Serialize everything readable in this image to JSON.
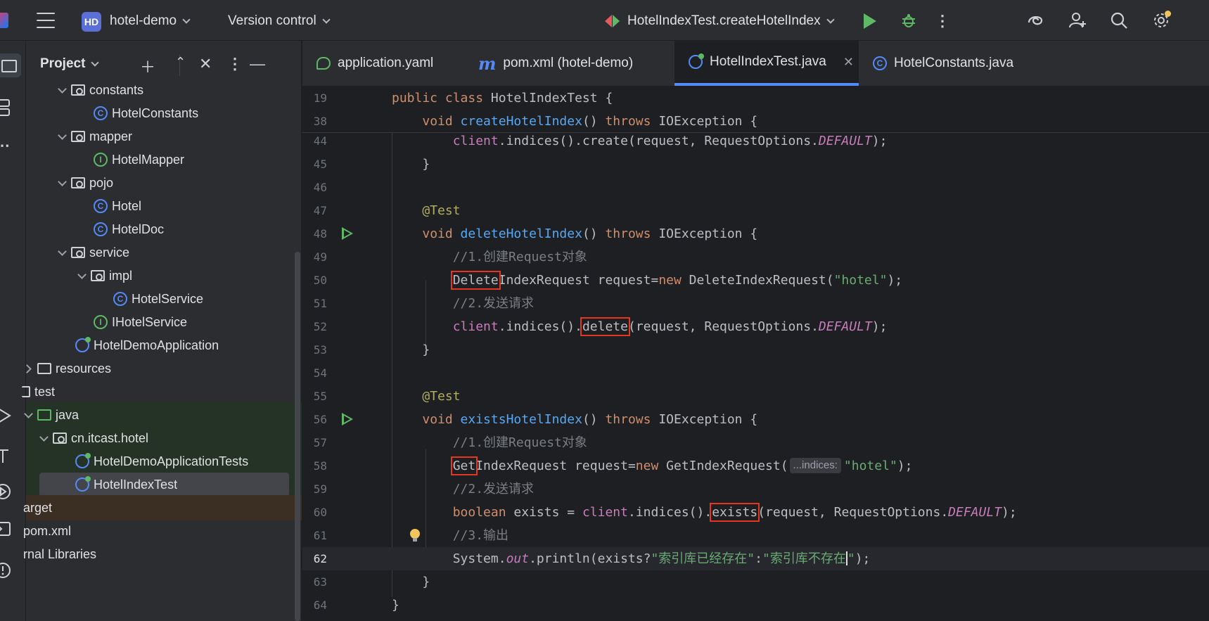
{
  "topbar": {
    "project_initials": "HD",
    "project_name": "hotel-demo",
    "version_control": "Version control",
    "run_config": "HotelIndexTest.createHotelIndex"
  },
  "project_panel": {
    "title": "Project",
    "tree": [
      {
        "label": "constants",
        "icon": "package-folder-icon"
      },
      {
        "label": "HotelConstants",
        "icon": "class-icon"
      },
      {
        "label": "mapper",
        "icon": "package-folder-icon"
      },
      {
        "label": "HotelMapper",
        "icon": "interface-icon"
      },
      {
        "label": "pojo",
        "icon": "package-folder-icon"
      },
      {
        "label": "Hotel",
        "icon": "class-icon"
      },
      {
        "label": "HotelDoc",
        "icon": "class-icon"
      },
      {
        "label": "service",
        "icon": "package-folder-icon"
      },
      {
        "label": "impl",
        "icon": "package-folder-icon"
      },
      {
        "label": "HotelService",
        "icon": "class-icon"
      },
      {
        "label": "IHotelService",
        "icon": "interface-icon"
      },
      {
        "label": "HotelDemoApplication",
        "icon": "spring-app-icon"
      },
      {
        "label": "resources",
        "icon": "resources-folder-icon"
      },
      {
        "label": "test",
        "icon": "folder-icon"
      },
      {
        "label": "java",
        "icon": "test-source-folder-icon"
      },
      {
        "label": "cn.itcast.hotel",
        "icon": "package-folder-icon"
      },
      {
        "label": "HotelDemoApplicationTests",
        "icon": "test-class-icon"
      },
      {
        "label": "HotelIndexTest",
        "icon": "test-class-icon"
      },
      {
        "label": "arget",
        "icon": ""
      },
      {
        "label": "pom.xml",
        "icon": ""
      },
      {
        "label": "rnal Libraries",
        "icon": ""
      }
    ]
  },
  "tabs": [
    {
      "label": "application.yaml"
    },
    {
      "label": "pom.xml (hotel-demo)"
    },
    {
      "label": "HotelIndexTest.java"
    },
    {
      "label": "HotelConstants.java"
    }
  ],
  "code": {
    "line_numbers": [
      "19",
      "38",
      "44",
      "45",
      "46",
      "47",
      "48",
      "49",
      "50",
      "51",
      "52",
      "53",
      "54",
      "55",
      "56",
      "57",
      "58",
      "59",
      "60",
      "61",
      "62",
      "63",
      "64"
    ],
    "class_name": "HotelIndexTest",
    "method_create": "createHotelIndex",
    "method_delete": "deleteHotelIndex",
    "method_exists": "existsHotelIndex",
    "comment_create_request": "//1.创建Request对象",
    "comment_send_request": "//2.发送请求",
    "comment_output": "//3.输出",
    "index_name": "\"hotel\"",
    "param_hint": "...indices:",
    "str_exists": "\"索引库已经存在\"",
    "str_not_exists": "\"索引库不存在",
    "str_close": "\""
  }
}
